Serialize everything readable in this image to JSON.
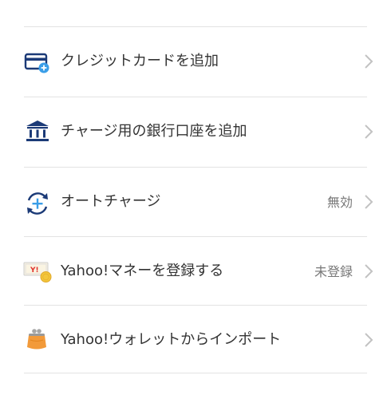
{
  "menu": {
    "items": [
      {
        "label": "クレジットカードを追加",
        "status": "",
        "icon": "credit-card-add-icon"
      },
      {
        "label": "チャージ用の銀行口座を追加",
        "status": "",
        "icon": "bank-icon"
      },
      {
        "label": "オートチャージ",
        "status": "無効",
        "icon": "auto-charge-icon"
      },
      {
        "label": "Yahoo!マネーを登録する",
        "status": "未登録",
        "icon": "yahoo-money-icon"
      },
      {
        "label": "Yahoo!ウォレットからインポート",
        "status": "",
        "icon": "wallet-purse-icon"
      }
    ]
  },
  "colors": {
    "brand_blue": "#1b3a77",
    "accent_blue": "#3a9ee8",
    "text": "#333333",
    "muted": "#777777",
    "divider": "#e3e3e3",
    "chevron": "#c2c2c2",
    "purse_orange": "#f29a3a",
    "coin_gold": "#f3c63b"
  }
}
